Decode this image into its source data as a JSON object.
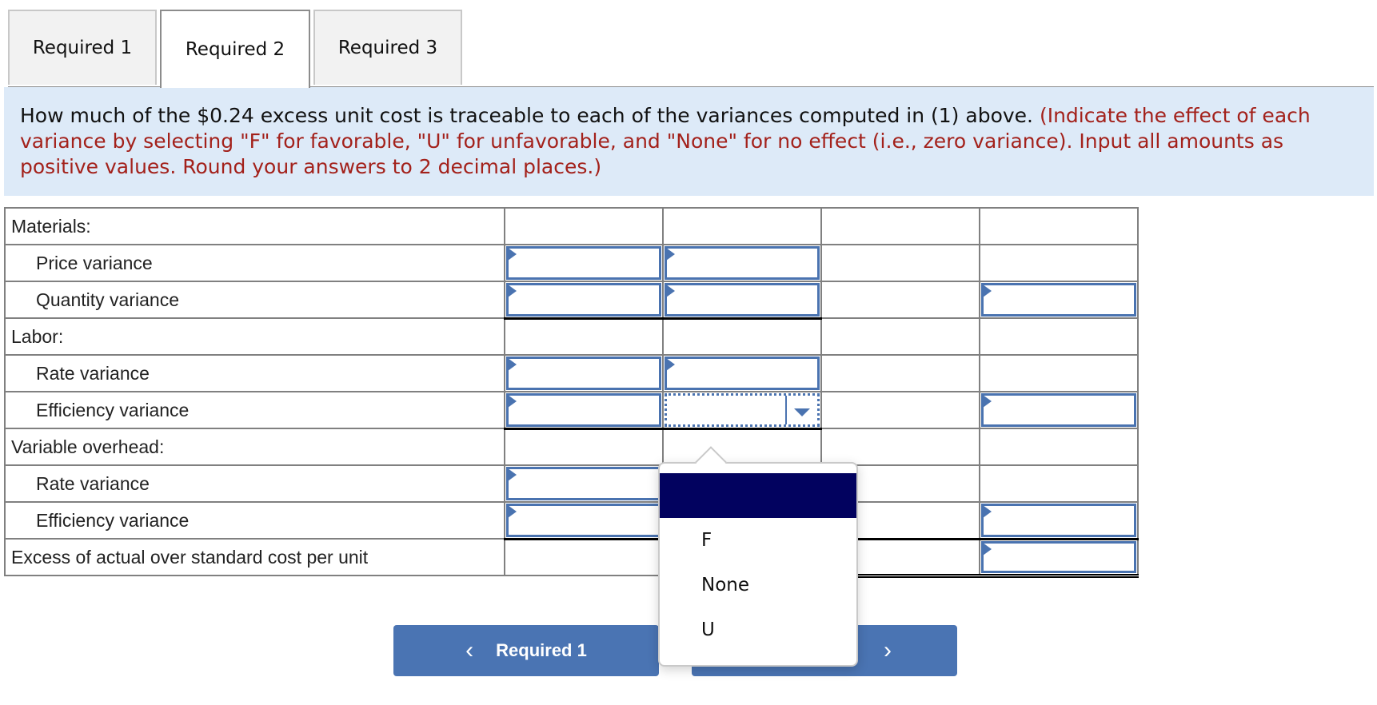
{
  "tabs": [
    {
      "label": "Required 1",
      "active": false
    },
    {
      "label": "Required 2",
      "active": true
    },
    {
      "label": "Required 3",
      "active": false
    }
  ],
  "instructions": {
    "question": "How much of the $0.24 excess unit cost is traceable to each of the variances computed in (1) above.",
    "note": "(Indicate the effect of each variance by selecting \"F\" for favorable, \"U\" for unfavorable, and \"None\" for no effect (i.e., zero variance). Input all amounts as positive values. Round your answers to 2 decimal places.)"
  },
  "table": {
    "rows": [
      {
        "label": "Materials:",
        "indent": false
      },
      {
        "label": "Price variance",
        "indent": true
      },
      {
        "label": "Quantity variance",
        "indent": true
      },
      {
        "label": "Labor:",
        "indent": false
      },
      {
        "label": "Rate variance",
        "indent": true
      },
      {
        "label": "Efficiency variance",
        "indent": true
      },
      {
        "label": "Variable overhead:",
        "indent": false
      },
      {
        "label": "Rate variance",
        "indent": true
      },
      {
        "label": "Efficiency variance",
        "indent": true
      },
      {
        "label": "Excess of actual over standard cost per unit",
        "indent": false
      }
    ]
  },
  "dropdown": {
    "selected": "",
    "options": [
      "",
      "F",
      "None",
      "U"
    ]
  },
  "nav": {
    "prev_label": "Required 1",
    "prev_icon": "chevron-left-icon",
    "next_label": "",
    "next_icon": "chevron-right-icon"
  },
  "colors": {
    "accent": "#4a74b3",
    "highlight": "#02025f",
    "instruction_bg": "#ddeaf8",
    "instruction_red": "#a3211b"
  }
}
